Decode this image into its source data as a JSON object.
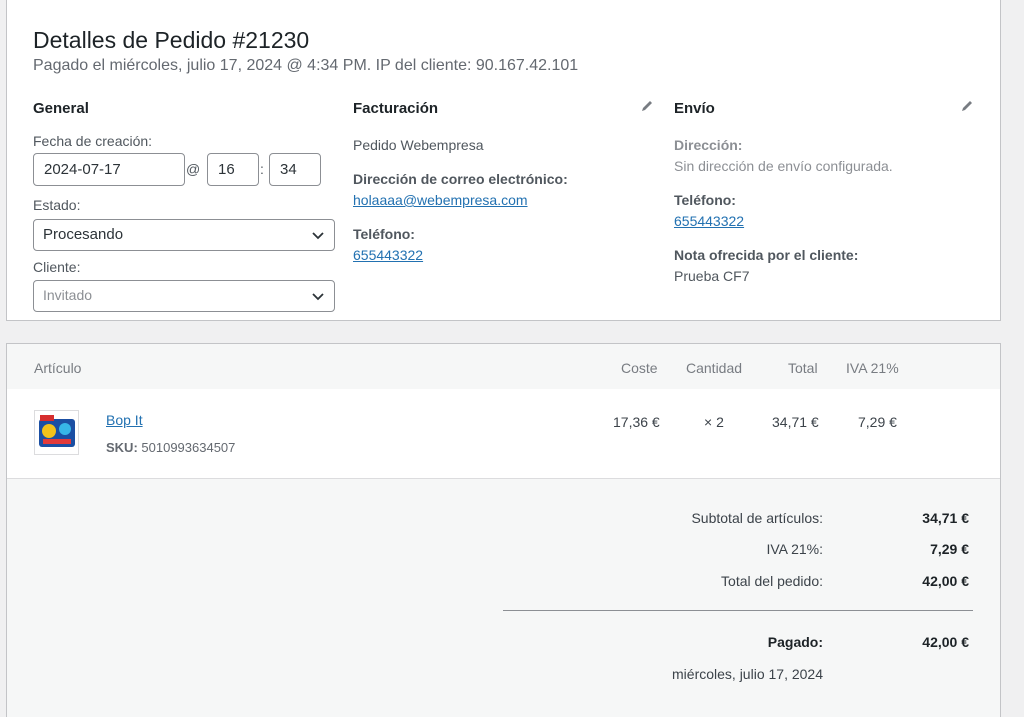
{
  "order": {
    "title": "Detalles de Pedido #21230",
    "subtitle": "Pagado el miércoles, julio 17, 2024 @ 4:34 PM. IP del cliente: 90.167.42.101"
  },
  "general": {
    "heading": "General",
    "date_label": "Fecha de creación:",
    "date_value": "2024-07-17",
    "at_symbol": "@",
    "hour_value": "16",
    "colon": ":",
    "minute_value": "34",
    "status_label": "Estado:",
    "status_value": "Procesando",
    "client_label": "Cliente:",
    "client_value": "Invitado"
  },
  "billing": {
    "heading": "Facturación",
    "name": "Pedido Webempresa",
    "email_label": "Dirección de correo electrónico:",
    "email": "holaaaa@webempresa.com",
    "phone_label": "Teléfono:",
    "phone": "655443322"
  },
  "shipping": {
    "heading": "Envío",
    "address_label": "Dirección:",
    "address_value": "Sin dirección de envío configurada.",
    "phone_label": "Teléfono:",
    "phone": "655443322",
    "note_label": "Nota ofrecida por el cliente:",
    "note_value": "Prueba CF7"
  },
  "items": {
    "headers": {
      "article": "Artículo",
      "cost": "Coste",
      "quantity": "Cantidad",
      "total": "Total",
      "tax": "IVA 21%"
    },
    "rows": [
      {
        "name": "Bop It",
        "sku_label": "SKU:",
        "sku": "5010993634507",
        "cost": "17,36 €",
        "quantity": "× 2",
        "total": "34,71 €",
        "tax": "7,29 €"
      }
    ]
  },
  "totals": {
    "subtotal_label": "Subtotal de artículos:",
    "subtotal_value": "34,71 €",
    "tax_label": "IVA 21%:",
    "tax_value": "7,29 €",
    "order_total_label": "Total del pedido:",
    "order_total_value": "42,00 €",
    "paid_label": "Pagado:",
    "paid_value": "42,00 €",
    "paid_date": "miércoles, julio 17, 2024"
  },
  "icons": {
    "edit": "pencil-icon",
    "dropdown": "chevron-down-icon"
  },
  "colors": {
    "link": "#2271b1",
    "border": "#c3c4c7"
  }
}
